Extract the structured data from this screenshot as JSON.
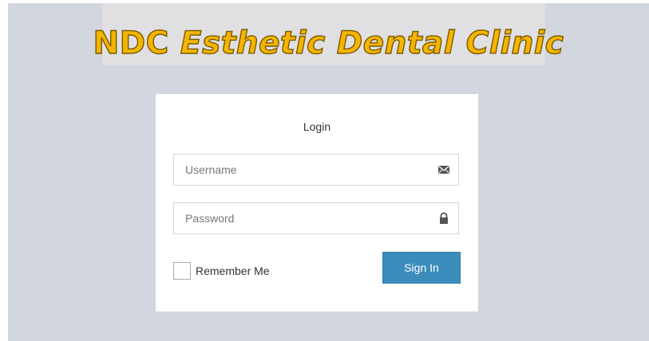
{
  "header": {
    "title_plain": "NDC ",
    "title_italic": "Esthetic Dental Clinic"
  },
  "login": {
    "box_message": "Login",
    "username_placeholder": "Username",
    "username_icon": "envelope-icon",
    "password_placeholder": "Password",
    "password_icon": "lock-icon",
    "remember_label": "Remember Me",
    "remember_checked": false,
    "signin_label": "Sign In"
  },
  "colors": {
    "page_background": "#d2d6de",
    "title_fill": "#f5b400",
    "title_outline": "#7a5a00",
    "primary_button": "#3c8dbc"
  }
}
